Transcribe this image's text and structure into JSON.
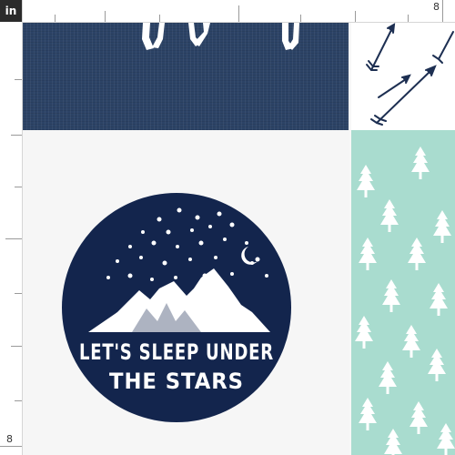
{
  "ruler": {
    "unit_label": "in",
    "top_number": "8",
    "left_number": "8"
  },
  "design": {
    "badge_line1": "LET'S SLEEP UNDER",
    "badge_line2": "THE STARS"
  },
  "colors": {
    "navy": "#13254d",
    "navy_linen": "#2c4366",
    "mint": "#a9dccf",
    "white": "#ffffff"
  },
  "icons": [
    "star-icon",
    "crescent-moon-icon",
    "mountain-icon",
    "tree-icon",
    "arrow-icon",
    "animal-legs-icon"
  ]
}
